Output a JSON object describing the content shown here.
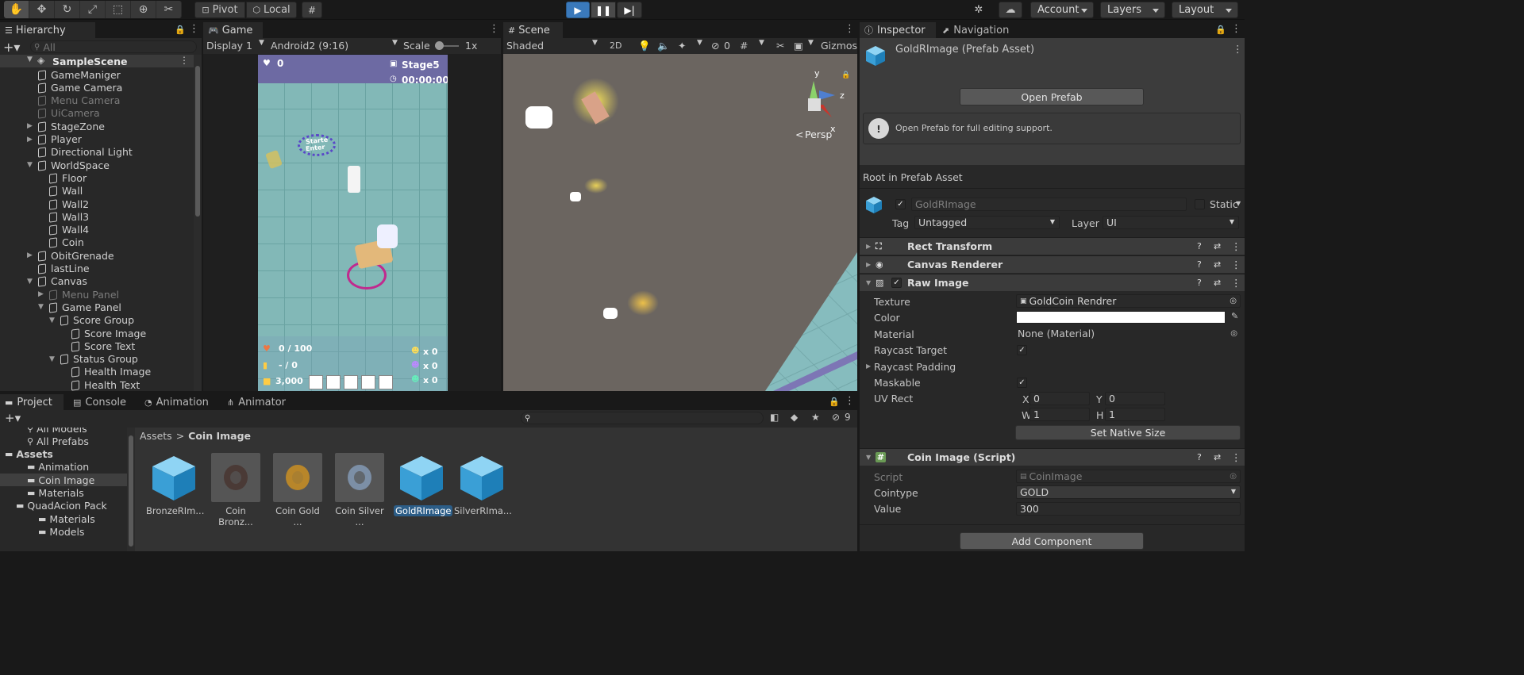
{
  "toolbar": {
    "tools": [
      "hand-tool-icon",
      "move-tool-icon",
      "rotate-tool-icon",
      "scale-tool-icon",
      "rect-tool-icon",
      "transform-tool-icon",
      "custom-tool-icon"
    ],
    "pivot_label": "Pivot",
    "local_label": "Local",
    "account_label": "Account",
    "layers_label": "Layers",
    "layout_label": "Layout"
  },
  "hierarchy": {
    "tab_label": "Hierarchy",
    "search_placeholder": "All",
    "scene_name": "SampleScene",
    "items": [
      {
        "label": "GameManiger",
        "indent": 1,
        "arrow": "",
        "dim": false
      },
      {
        "label": "Game Camera",
        "indent": 1,
        "arrow": "",
        "dim": false
      },
      {
        "label": "Menu Camera",
        "indent": 1,
        "arrow": "",
        "dim": true
      },
      {
        "label": "UiCamera",
        "indent": 1,
        "arrow": "",
        "dim": true
      },
      {
        "label": "StageZone",
        "indent": 1,
        "arrow": "right",
        "dim": false
      },
      {
        "label": "Player",
        "indent": 1,
        "arrow": "right",
        "dim": false
      },
      {
        "label": "Directional Light",
        "indent": 1,
        "arrow": "",
        "dim": false
      },
      {
        "label": "WorldSpace",
        "indent": 1,
        "arrow": "down",
        "dim": false
      },
      {
        "label": "Floor",
        "indent": 2,
        "arrow": "",
        "dim": false
      },
      {
        "label": "Wall",
        "indent": 2,
        "arrow": "",
        "dim": false
      },
      {
        "label": "Wall2",
        "indent": 2,
        "arrow": "",
        "dim": false
      },
      {
        "label": "Wall3",
        "indent": 2,
        "arrow": "",
        "dim": false
      },
      {
        "label": "Wall4",
        "indent": 2,
        "arrow": "",
        "dim": false
      },
      {
        "label": "Coin",
        "indent": 2,
        "arrow": "",
        "dim": false
      },
      {
        "label": "ObitGrenade",
        "indent": 1,
        "arrow": "right",
        "dim": false
      },
      {
        "label": "lastLine",
        "indent": 1,
        "arrow": "",
        "dim": false
      },
      {
        "label": "Canvas",
        "indent": 1,
        "arrow": "down",
        "dim": false
      },
      {
        "label": "Menu Panel",
        "indent": 2,
        "arrow": "right",
        "dim": true
      },
      {
        "label": "Game Panel",
        "indent": 2,
        "arrow": "down",
        "dim": false
      },
      {
        "label": "Score Group",
        "indent": 3,
        "arrow": "down",
        "dim": false
      },
      {
        "label": "Score Image",
        "indent": 4,
        "arrow": "",
        "dim": false
      },
      {
        "label": "Score Text",
        "indent": 4,
        "arrow": "",
        "dim": false
      },
      {
        "label": "Status Group",
        "indent": 3,
        "arrow": "down",
        "dim": false
      },
      {
        "label": "Health Image",
        "indent": 4,
        "arrow": "",
        "dim": false
      },
      {
        "label": "Health Text",
        "indent": 4,
        "arrow": "",
        "dim": false
      }
    ]
  },
  "game": {
    "tab_label": "Game",
    "display": "Display 1",
    "resolution": "Android2 (9:16)",
    "scale_label": "Scale",
    "scale_value": "1x",
    "hud": {
      "hearts": "0",
      "stage": "Stage5",
      "time": "00:00:00",
      "health": "0 / 100",
      "ammo": "- / 0",
      "gold": "3,000",
      "enemy_counts": [
        "x 0",
        "x 0",
        "x 0"
      ],
      "start_text_1": "Starte",
      "start_text_2": "Enter"
    }
  },
  "scene": {
    "tab_label": "Scene",
    "shading": "Shaded",
    "mode_2d": "2D",
    "hidden_count": "0",
    "gizmos_label": "Gizmos",
    "persp_label": "Persp",
    "axes": {
      "y": "y",
      "z": "z",
      "x": "x"
    }
  },
  "inspector": {
    "tab_label": "Inspector",
    "nav_tab_label": "Navigation",
    "asset_title": "GoldRImage (Prefab Asset)",
    "open_prefab": "Open Prefab",
    "help_text": "Open Prefab for full editing support.",
    "root_label": "Root in Prefab Asset",
    "object_name": "GoldRImage",
    "static_label": "Static",
    "tag_label": "Tag",
    "tag_value": "Untagged",
    "layer_label": "Layer",
    "layer_value": "UI",
    "components": {
      "rect": "Rect Transform",
      "canvas": "Canvas Renderer",
      "raw": "Raw Image",
      "script": "Coin Image (Script)"
    },
    "raw_image": {
      "texture_label": "Texture",
      "texture_value": "GoldCoin Rendrer",
      "color_label": "Color",
      "color_value": "#ffffff",
      "material_label": "Material",
      "material_value": "None (Material)",
      "raycast_target_label": "Raycast Target",
      "raycast_padding_label": "Raycast Padding",
      "maskable_label": "Maskable",
      "uv_rect_label": "UV Rect",
      "uv_x_label": "X",
      "uv_x": "0",
      "uv_y_label": "Y",
      "uv_y": "0",
      "uv_w_label": "W",
      "uv_w": "1",
      "uv_h_label": "H",
      "uv_h": "1",
      "set_native": "Set Native Size"
    },
    "script_comp": {
      "script_label": "Script",
      "script_value": "CoinImage",
      "cointype_label": "Cointype",
      "cointype_value": "GOLD",
      "value_label": "Value",
      "value_value": "300"
    },
    "add_component": "Add Component"
  },
  "bottom": {
    "tabs": [
      "Project",
      "Console",
      "Animation",
      "Animator"
    ],
    "hidden_count": "9",
    "tree": [
      {
        "label": "All Models",
        "indent": 2,
        "partial": true
      },
      {
        "label": "All Prefabs",
        "indent": 2
      },
      {
        "label": "Assets",
        "indent": 0,
        "bold": true
      },
      {
        "label": "Animation",
        "indent": 2
      },
      {
        "label": "Coin Image",
        "indent": 2,
        "selected": true
      },
      {
        "label": "Materials",
        "indent": 2
      },
      {
        "label": "QuadAcion Pack",
        "indent": 1
      },
      {
        "label": "Materials",
        "indent": 3
      },
      {
        "label": "Models",
        "indent": 3
      }
    ],
    "breadcrumb_root": "Assets",
    "breadcrumb_current": "Coin Image",
    "assets": [
      {
        "label": "BronzeRIm...",
        "kind": "prefab"
      },
      {
        "label": "Coin Bronz...",
        "kind": "bronze"
      },
      {
        "label": "Coin Gold ...",
        "kind": "gold"
      },
      {
        "label": "Coin Silver ...",
        "kind": "silver"
      },
      {
        "label": "GoldRImage",
        "kind": "prefab",
        "selected": true
      },
      {
        "label": "SilverRIma...",
        "kind": "prefab"
      }
    ]
  },
  "colors": {
    "accent": "#2c5d87",
    "play_active": "#3a79bb",
    "floor": "#7fb4b3",
    "scene_bg": "#6b6560",
    "hud_bar": "#6d6aa3"
  }
}
